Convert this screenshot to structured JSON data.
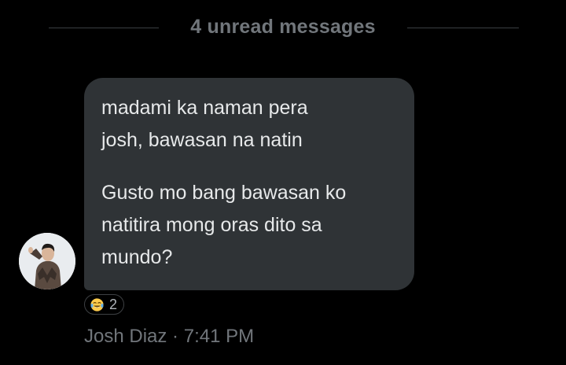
{
  "divider": {
    "text": "4 unread messages"
  },
  "message": {
    "lines_1": "madami ka naman pera\njosh, bawasan na natin",
    "lines_2": "Gusto mo bang bawasan ko\nnatitira mong oras dito sa\nmundo?"
  },
  "reaction": {
    "emoji_icon": "tears-of-joy-emoji-icon",
    "count": "2"
  },
  "meta": {
    "sender": "Josh Diaz",
    "separator": "·",
    "time": "7:41 PM"
  },
  "colors": {
    "background": "#000000",
    "bubble": "#2f3336",
    "text": "#e7e9ea",
    "muted": "#71767b"
  }
}
